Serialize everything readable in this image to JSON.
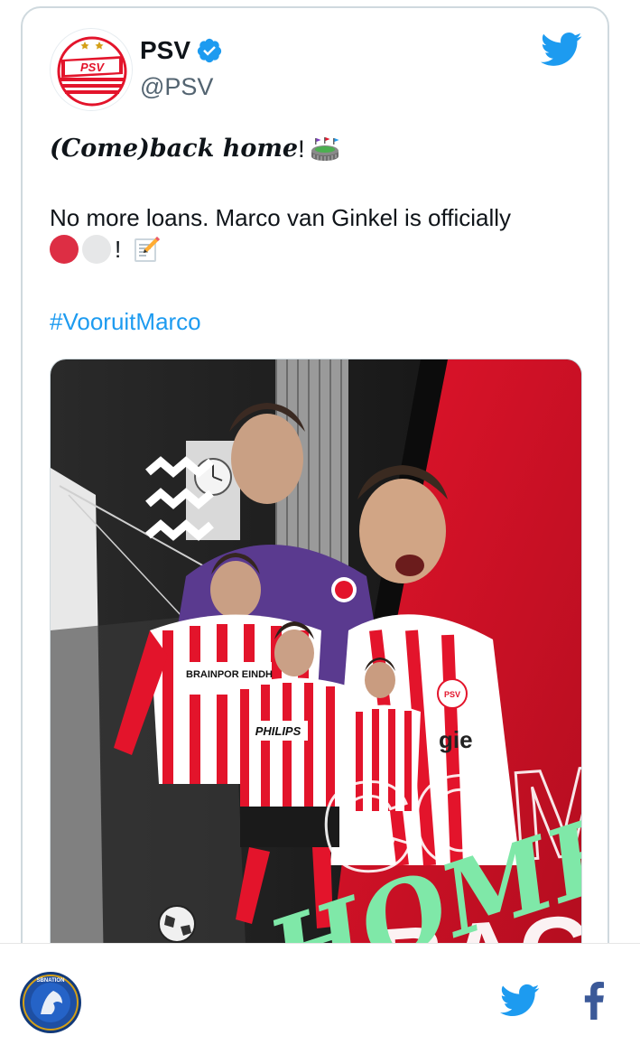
{
  "tweet": {
    "author_name": "PSV",
    "author_handle": "@PSV",
    "line1_text": "(Come)back home",
    "line1_exclaim": "!",
    "line2_text": "No more loans. Marco van Ginkel is officially",
    "line3_exclaim": "!",
    "hashtag": "#VooruitMarco",
    "avatar_logo_text": "PSV",
    "icons": [
      "verified-badge-icon",
      "twitter-bird-icon",
      "stadium-emoji-icon",
      "red-circle-emoji",
      "white-circle-emoji",
      "memo-emoji-icon"
    ]
  },
  "media": {
    "logo_text": "PSV",
    "sponsor_1": "BRAINPOR EINDH",
    "sponsor_2": "PHILIPS",
    "partial_text": "gie",
    "overlay_word_1": "COME",
    "overlay_word_2": "BACK",
    "overlay_script": "HOME"
  },
  "footer": {
    "site_logo_text": "SBNATION",
    "share_icons": [
      "twitter-share-icon",
      "facebook-share-icon"
    ]
  },
  "colors": {
    "twitter_blue": "#1d9bf0",
    "psv_red": "#e3142b",
    "mint": "#7fe8a8",
    "text_gray": "#536471",
    "border": "#cfd9de",
    "facebook_blue": "#3b5998",
    "sbn_navy": "#123a7a"
  }
}
